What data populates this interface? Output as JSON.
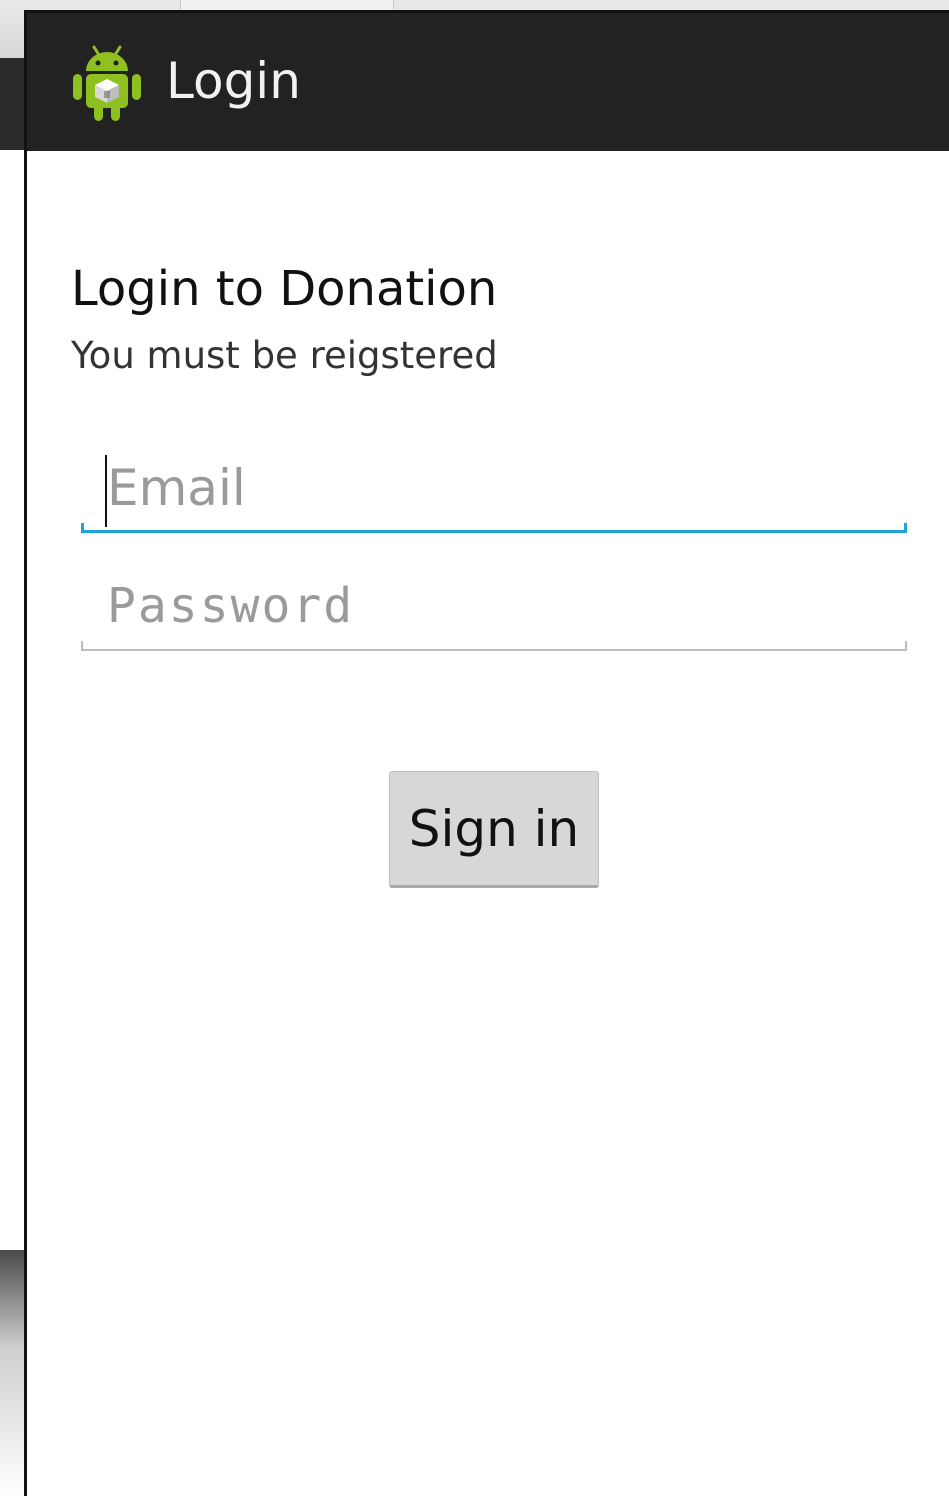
{
  "actionbar": {
    "title": "Login",
    "icon": "android-app-icon"
  },
  "content": {
    "heading": "Login to Donation",
    "subheading": "You must be reigstered"
  },
  "form": {
    "email": {
      "value": "",
      "placeholder": "Email",
      "focused": true
    },
    "password": {
      "value": "",
      "placeholder": "Password"
    },
    "signin_label": "Sign in"
  },
  "colors": {
    "actionbar_bg": "#222222",
    "focus_accent": "#1fa3d8",
    "button_bg": "#d7d7d7",
    "android_green": "#8ec020"
  }
}
